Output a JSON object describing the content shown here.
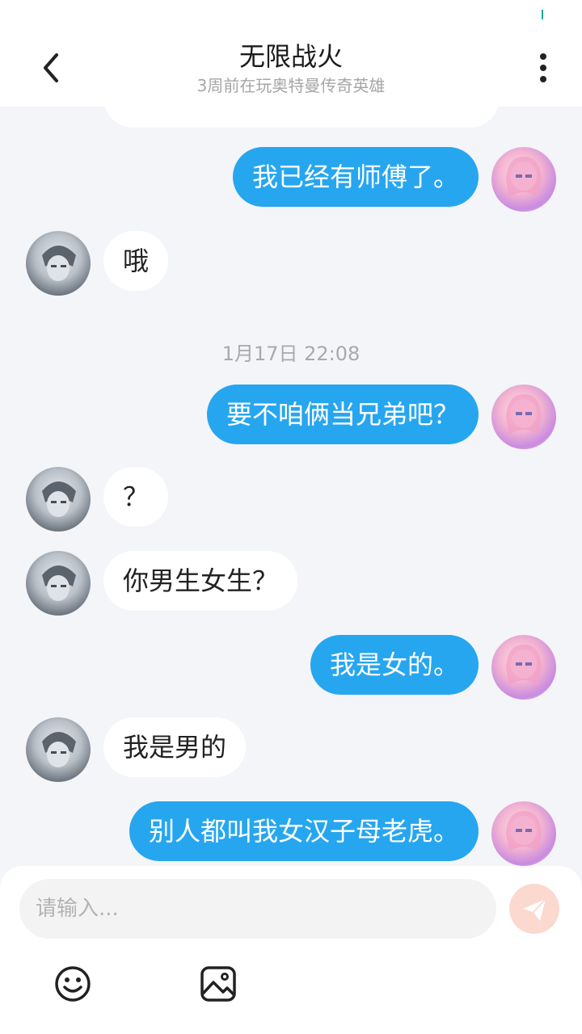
{
  "header": {
    "title": "无限战火",
    "subtitle": "3周前在玩奥特曼传奇英雄"
  },
  "messages": [
    {
      "side": "in",
      "text": "",
      "partial": true
    },
    {
      "side": "out",
      "text": "我已经有师傅了。"
    },
    {
      "side": "in",
      "text": "哦"
    },
    {
      "type": "timestamp",
      "text": "1月17日 22:08"
    },
    {
      "side": "out",
      "text": "要不咱俩当兄弟吧？"
    },
    {
      "side": "in",
      "text": "？"
    },
    {
      "side": "in",
      "text": "你男生女生？"
    },
    {
      "side": "out",
      "text": "我是女的。"
    },
    {
      "side": "in",
      "text": "我是男的"
    },
    {
      "side": "out",
      "text": "别人都叫我女汉子母老虎。"
    }
  ],
  "input": {
    "placeholder": "请输入..."
  },
  "icons": {
    "back": "chevron-left-icon",
    "more": "more-vertical-icon",
    "send": "send-icon",
    "emoji": "emoji-icon",
    "image": "image-icon"
  },
  "colors": {
    "outgoing_bubble": "#27a6f0",
    "incoming_bubble": "#ffffff",
    "background": "#f3f5f8",
    "send_button": "#fbd9cf"
  }
}
